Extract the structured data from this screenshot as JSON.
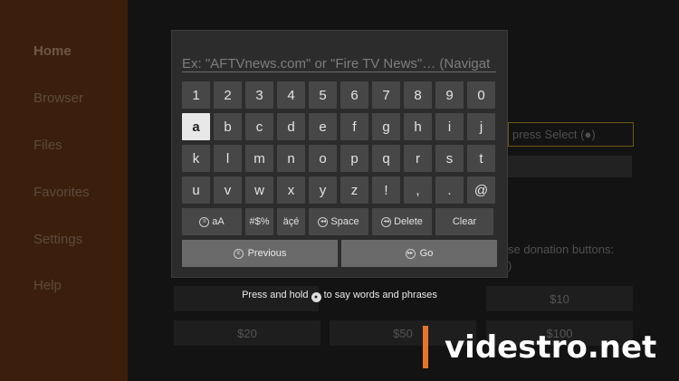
{
  "sidebar": {
    "items": [
      {
        "label": "Home"
      },
      {
        "label": "Browser"
      },
      {
        "label": "Files"
      },
      {
        "label": "Favorites"
      },
      {
        "label": "Settings"
      },
      {
        "label": "Help"
      }
    ]
  },
  "background": {
    "select_hint": "press Select (●)",
    "donation_text": "se donation buttons:",
    "donation_paren": ")",
    "donation_buttons": [
      "$10",
      "$20",
      "$50",
      "$100"
    ]
  },
  "keyboard": {
    "search_placeholder": "Ex: \"AFTVnews.com\" or \"Fire TV News\"… (Navigat",
    "rows": [
      [
        "1",
        "2",
        "3",
        "4",
        "5",
        "6",
        "7",
        "8",
        "9",
        "0"
      ],
      [
        "a",
        "b",
        "c",
        "d",
        "e",
        "f",
        "g",
        "h",
        "i",
        "j"
      ],
      [
        "k",
        "l",
        "m",
        "n",
        "o",
        "p",
        "q",
        "r",
        "s",
        "t"
      ],
      [
        "u",
        "v",
        "w",
        "x",
        "y",
        "z",
        "!",
        ",",
        ".",
        "@"
      ]
    ],
    "selected_key": "a",
    "function_keys": {
      "case": "aA",
      "symbols": "#$%",
      "accents": "äçé",
      "space": "Space",
      "delete": "Delete",
      "clear": "Clear"
    },
    "previous_label": "Previous",
    "go_label": "Go",
    "voice_hint_before": "Press and hold",
    "voice_hint_after": "to say words and phrases"
  },
  "watermark": "videstro.net",
  "colors": {
    "sidebar": "#3b1f0c",
    "key": "#474747",
    "key_selected": "#e8e8e8",
    "accent": "#e8742a"
  }
}
